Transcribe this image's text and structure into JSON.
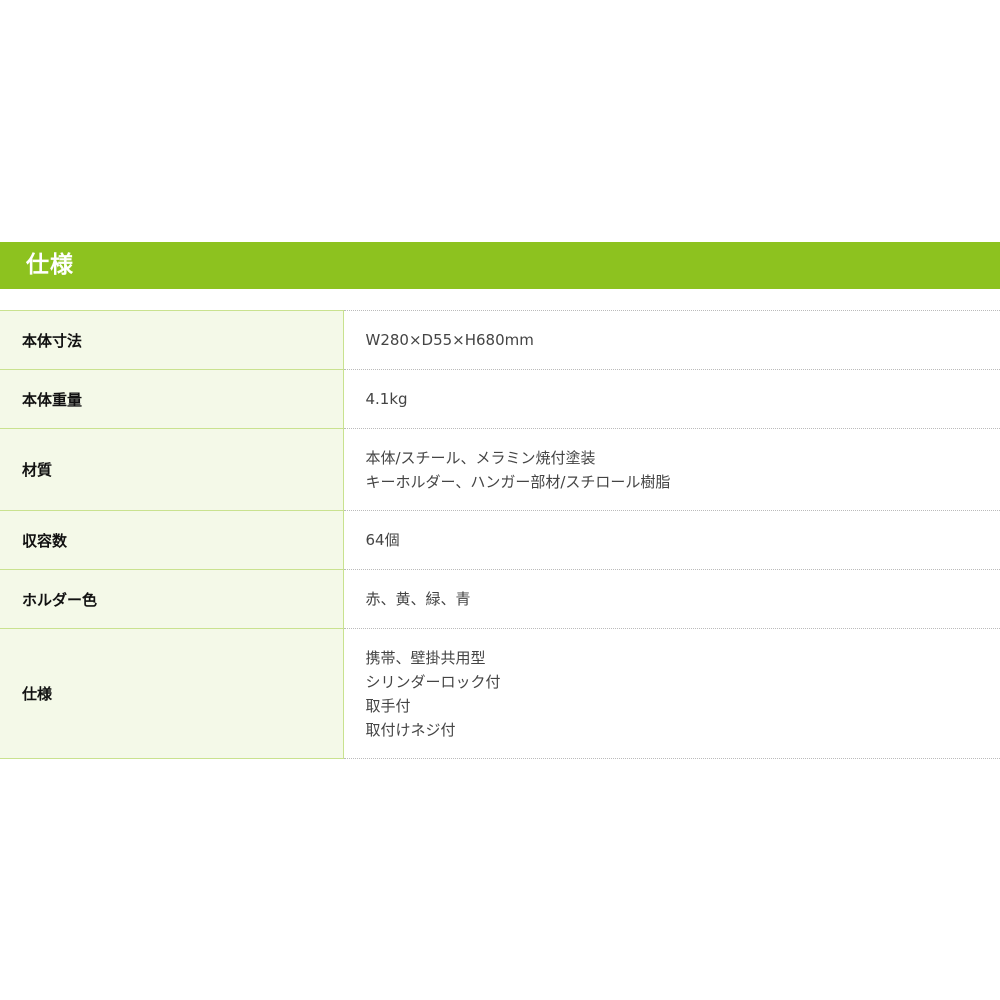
{
  "section": {
    "title": "仕様"
  },
  "specs": [
    {
      "label": "本体寸法",
      "values": [
        "W280×D55×H680mm"
      ]
    },
    {
      "label": "本体重量",
      "values": [
        "4.1kg"
      ]
    },
    {
      "label": "材質",
      "values": [
        "本体/スチール、メラミン焼付塗装",
        "キーホルダー、ハンガー部材/スチロール樹脂"
      ]
    },
    {
      "label": "収容数",
      "values": [
        "64個"
      ]
    },
    {
      "label": "ホルダー色",
      "values": [
        "赤、黄、緑、青"
      ]
    },
    {
      "label": "仕様",
      "values": [
        "携帯、壁掛共用型",
        "シリンダーロック付",
        "取手付",
        "取付けネジ付"
      ]
    }
  ],
  "colors": {
    "header_bg": "#8dc21f",
    "label_bg": "#f4f9e8",
    "label_border": "#c9e28f"
  }
}
